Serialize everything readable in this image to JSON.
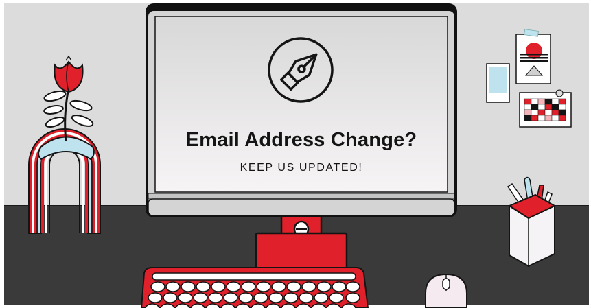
{
  "headline": "Email Address Change?",
  "subline": "KEEP US UPDATED!",
  "icons": {
    "screen_icon": "pen-nib-icon",
    "flower": "tulip",
    "vase": "rainbow-arch-vase",
    "pencil_cup": "pencil-cup",
    "mouse": "computer-mouse",
    "keyboard": "typewriter-keyboard"
  },
  "colors": {
    "wall": "#dcdcdc",
    "desk": "#3a3a3a",
    "accent_red": "#e0202a",
    "ink": "#141414",
    "light_blue": "#bfe3ee"
  }
}
